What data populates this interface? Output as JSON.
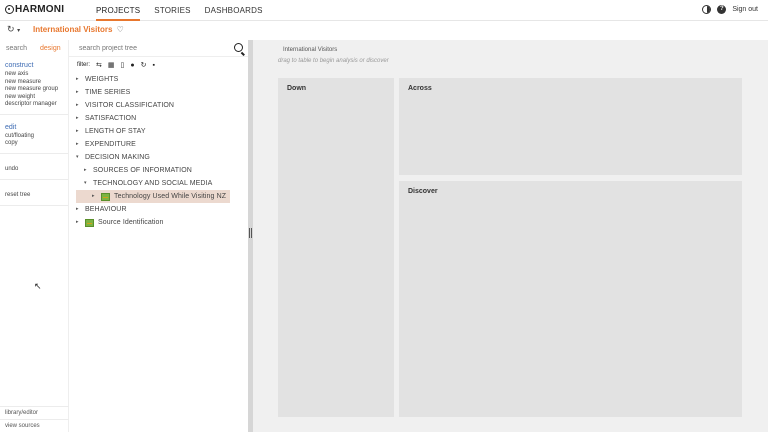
{
  "app": {
    "logo": "HARMONI"
  },
  "nav": {
    "items": [
      "PROJECTS",
      "STORIES",
      "DASHBOARDS"
    ],
    "active": "PROJECTS"
  },
  "top_right": {
    "signout": "Sign out",
    "help": "?"
  },
  "subbar": {
    "history_icon": "↻",
    "history_caret": "▾",
    "project_title": "International Visitors",
    "favorite_icon": "♡"
  },
  "left_panel": {
    "tabs": [
      "search",
      "design"
    ],
    "active_tab": "design",
    "construct": {
      "title": "construct",
      "links": [
        "new axis",
        "new measure",
        "new measure group",
        "new weight",
        "descriptor manager"
      ]
    },
    "edit": {
      "title": "edit",
      "links": [
        "cut/floating",
        "copy"
      ]
    },
    "undo": "undo",
    "reset_tree": "reset tree",
    "bottom": {
      "library_editor": "library/editor",
      "view_sources": "view sources"
    }
  },
  "tree_panel": {
    "search_placeholder": "search project tree",
    "toolbar": {
      "filter_label": "filter:"
    },
    "items": [
      {
        "label": "WEIGHTS",
        "arrow": "▸"
      },
      {
        "label": "TIME SERIES",
        "arrow": "▸"
      },
      {
        "label": "VISITOR CLASSIFICATION",
        "arrow": "▸"
      },
      {
        "label": "SATISFACTION",
        "arrow": "▸"
      },
      {
        "label": "LENGTH OF STAY",
        "arrow": "▸"
      },
      {
        "label": "EXPENDITURE",
        "arrow": "▸"
      },
      {
        "label": "DECISION MAKING",
        "arrow": "▾"
      },
      {
        "label": "SOURCES OF INFORMATION",
        "arrow": "▸"
      },
      {
        "label": "TECHNOLOGY AND SOCIAL MEDIA",
        "arrow": "▾"
      },
      {
        "label": "Technology Used While Visiting NZ",
        "arrow": "▸"
      },
      {
        "label": "BEHAVIOUR",
        "arrow": "▸"
      },
      {
        "label": "Source Identification",
        "arrow": "▸"
      }
    ]
  },
  "main": {
    "title": "International Visitors",
    "hint": "drag to table to begin analysis or discover",
    "boxes": {
      "down": "Down",
      "across": "Across",
      "discover": "Discover"
    }
  }
}
